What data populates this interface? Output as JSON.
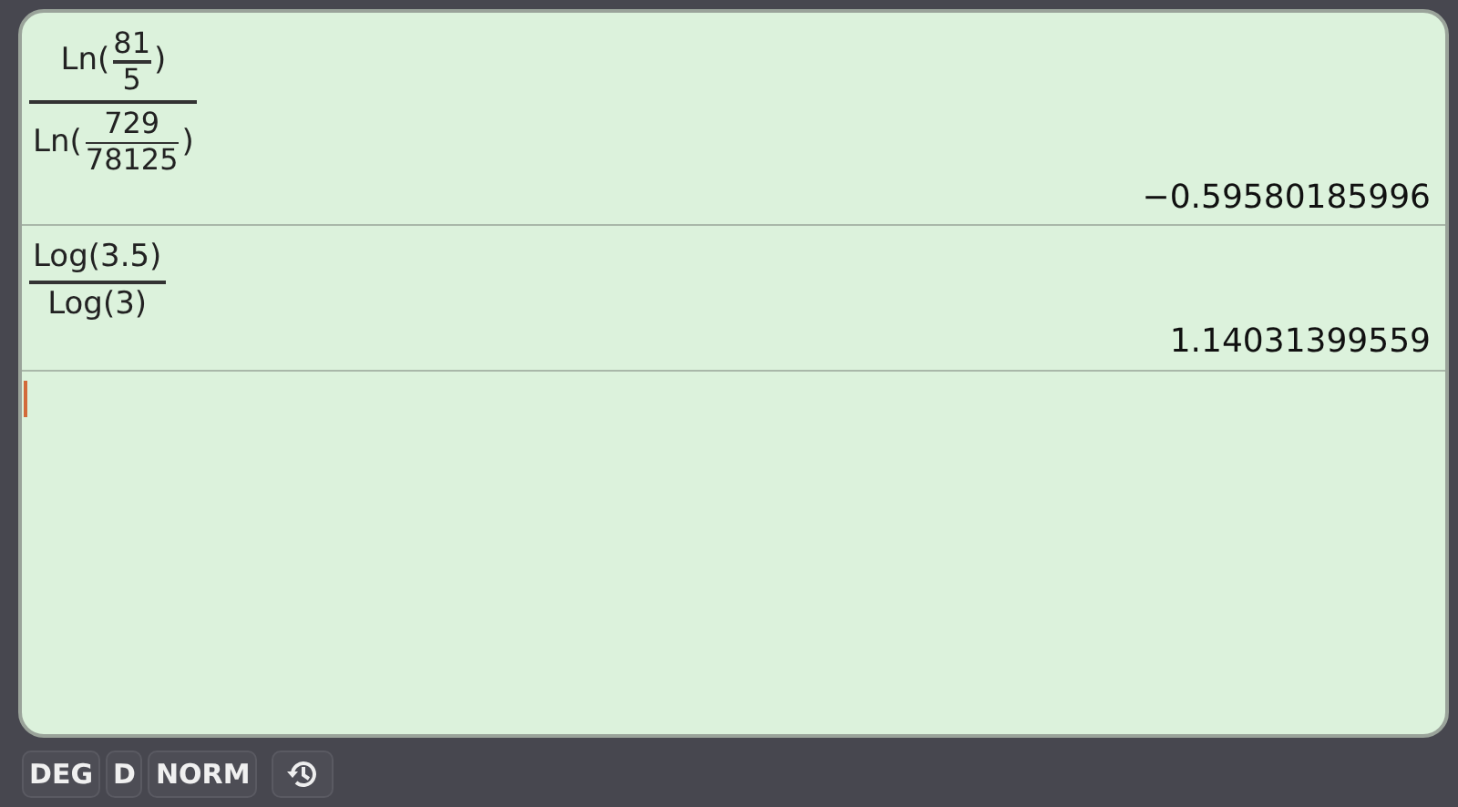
{
  "history": [
    {
      "numerator": {
        "func": "Ln(",
        "fraction": {
          "num": "81",
          "den": "5"
        },
        "close": ")"
      },
      "denominator": {
        "func": "Ln(",
        "fraction": {
          "num": "729",
          "den": "78125"
        },
        "close": ")"
      },
      "result": "−0.59580185996"
    },
    {
      "numerator": {
        "text": "Log(3.5)"
      },
      "denominator": {
        "text": "Log(3)"
      },
      "result": "1.14031399559"
    }
  ],
  "status_bar": {
    "buttons": [
      "DEG",
      "D",
      "NORM"
    ]
  }
}
